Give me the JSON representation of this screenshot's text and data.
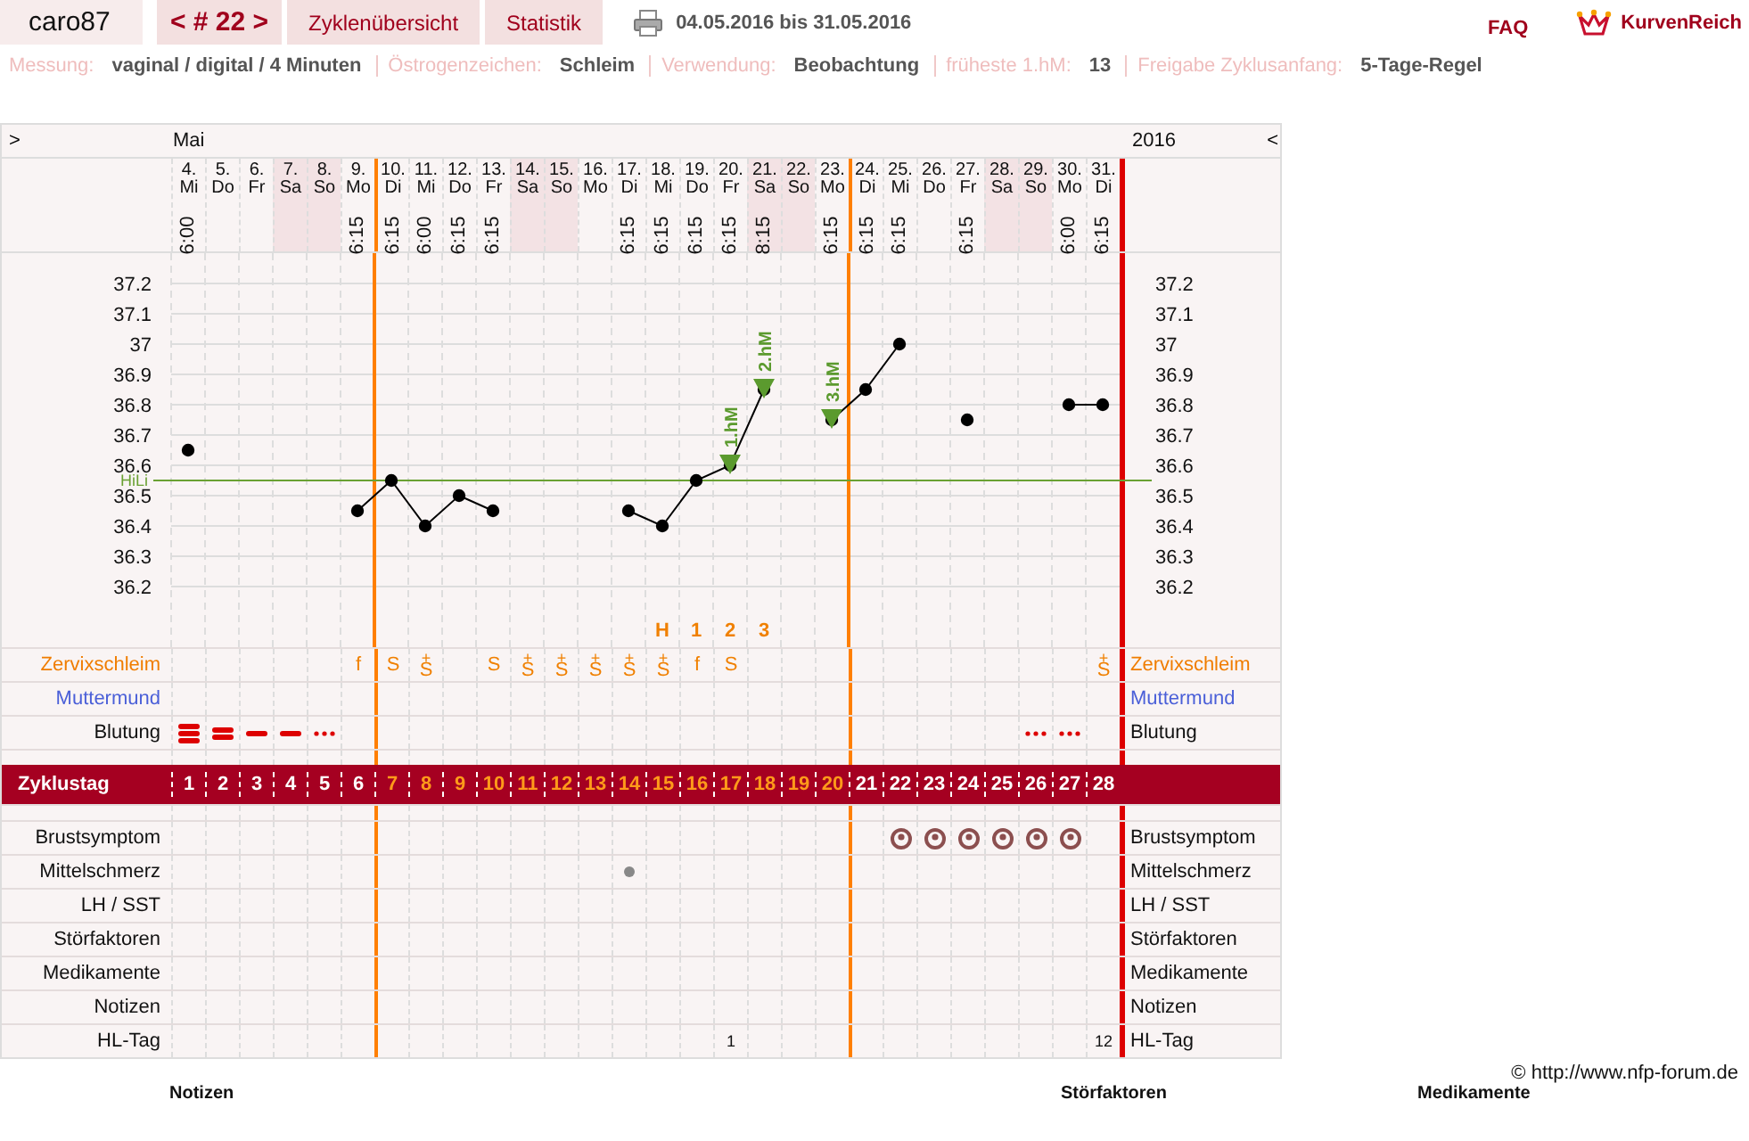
{
  "header": {
    "user": "caro87",
    "cycle_nav": "< # 22 >",
    "tabs": [
      {
        "label": "Zyklenübersicht"
      },
      {
        "label": "Statistik"
      }
    ],
    "date_range": "04.05.2016 bis 31.05.2016",
    "faq": "FAQ",
    "logo": "KurvenReich"
  },
  "settings": [
    {
      "label": "Messung:",
      "value": "vaginal / digital / 4 Minuten"
    },
    {
      "label": "Östrogenzeichen:",
      "value": "Schleim"
    },
    {
      "label": "Verwendung:",
      "value": "Beobachtung"
    },
    {
      "label": "früheste 1.hM:",
      "value": "13"
    },
    {
      "label": "Freigabe Zyklusanfang:",
      "value": "5-Tage-Regel"
    }
  ],
  "calendar": {
    "nav_left": ">",
    "month": "Mai",
    "year": "2016",
    "nav_right": "<"
  },
  "days": [
    {
      "weekday": "Mi",
      "time": "6:00",
      "weekend": false,
      "cycle_day": "1",
      "fertile": false,
      "bleeding": {
        "kind": "heavy"
      }
    },
    {
      "weekday": "Do",
      "weekend": false,
      "cycle_day": "2",
      "fertile": false,
      "bleeding": {
        "kind": "medium"
      }
    },
    {
      "weekday": "Fr",
      "weekend": false,
      "cycle_day": "3",
      "fertile": false,
      "bleeding": {
        "kind": "light"
      }
    },
    {
      "weekday": "Sa",
      "weekend": true,
      "cycle_day": "4",
      "fertile": false,
      "bleeding": {
        "kind": "light"
      }
    },
    {
      "weekday": "So",
      "weekend": true,
      "cycle_day": "5",
      "fertile": false,
      "bleeding": {
        "kind": "spotting"
      }
    },
    {
      "weekday": "Mo",
      "time": "6:15",
      "weekend": false,
      "cycle_day": "6",
      "fertile": false,
      "mucus": "f"
    },
    {
      "weekday": "Di",
      "time": "6:15",
      "weekend": false,
      "cycle_day": "7",
      "fertile": true,
      "mucus": "S"
    },
    {
      "weekday": "Mi",
      "time": "6:00",
      "weekend": false,
      "cycle_day": "8",
      "fertile": true,
      "mucus": "S",
      "mucus_mark": "+"
    },
    {
      "weekday": "Do",
      "time": "6:15",
      "weekend": false,
      "cycle_day": "9",
      "fertile": true
    },
    {
      "weekday": "Fr",
      "time": "6:15",
      "weekend": false,
      "cycle_day": "10",
      "fertile": true,
      "mucus": "S"
    },
    {
      "weekday": "Sa",
      "weekend": true,
      "cycle_day": "11",
      "fertile": true,
      "mucus": "S",
      "mucus_mark": "+"
    },
    {
      "weekday": "So",
      "weekend": true,
      "cycle_day": "12",
      "fertile": true,
      "mucus": "S",
      "mucus_mark": "+"
    },
    {
      "weekday": "Mo",
      "weekend": false,
      "cycle_day": "13",
      "fertile": true,
      "mucus": "S",
      "mucus_mark": "+"
    },
    {
      "weekday": "Di",
      "time": "6:15",
      "weekend": false,
      "cycle_day": "14",
      "fertile": true,
      "mucus": "S",
      "mucus_mark": "+",
      "pain": true
    },
    {
      "weekday": "Mi",
      "time": "6:15",
      "weekend": false,
      "cycle_day": "15",
      "fertile": true,
      "mucus": "S",
      "mucus_mark": "+",
      "marker": "H"
    },
    {
      "weekday": "Do",
      "time": "6:15",
      "weekend": false,
      "cycle_day": "16",
      "fertile": true,
      "mucus": "f",
      "marker": "1"
    },
    {
      "weekday": "Fr",
      "time": "6:15",
      "weekend": false,
      "cycle_day": "17",
      "fertile": true,
      "mucus": "S",
      "marker": "2",
      "hl_tag": "1"
    },
    {
      "weekday": "Sa",
      "time": "8:15",
      "weekend": true,
      "cycle_day": "18",
      "fertile": true,
      "marker": "3"
    },
    {
      "weekday": "So",
      "weekend": true,
      "cycle_day": "19",
      "fertile": true
    },
    {
      "weekday": "Mo",
      "time": "6:15",
      "weekend": false,
      "cycle_day": "20",
      "fertile": true
    },
    {
      "weekday": "Di",
      "time": "6:15",
      "weekend": false,
      "cycle_day": "21",
      "fertile": false
    },
    {
      "weekday": "Mi",
      "time": "6:15",
      "weekend": false,
      "cycle_day": "22",
      "fertile": false,
      "breast": true
    },
    {
      "weekday": "Do",
      "weekend": false,
      "cycle_day": "23",
      "fertile": false,
      "breast": true
    },
    {
      "weekday": "Fr",
      "time": "6:15",
      "weekend": false,
      "cycle_day": "24",
      "fertile": false,
      "breast": true
    },
    {
      "weekday": "Sa",
      "weekend": true,
      "cycle_day": "25",
      "fertile": false,
      "breast": true
    },
    {
      "weekday": "So",
      "weekend": true,
      "cycle_day": "26",
      "fertile": false,
      "breast": true,
      "bleeding": {
        "kind": "spotting"
      }
    },
    {
      "weekday": "Mo",
      "time": "6:00",
      "weekend": false,
      "cycle_day": "27",
      "fertile": false,
      "breast": true,
      "bleeding": {
        "kind": "spotting"
      }
    },
    {
      "weekday": "Di",
      "time": "6:15",
      "weekend": false,
      "cycle_day": "28",
      "fertile": false,
      "mucus": "S",
      "mucus_mark": "+",
      "hl_tag": "12"
    }
  ],
  "temperature": {
    "left_ticks": [
      "37.2",
      "37.1",
      "37",
      "36.9",
      "36.8",
      "36.7",
      "36.6",
      "36.5",
      "36.4",
      "36.3",
      "36.2"
    ],
    "chart_data": {
      "type": "line",
      "grid": true,
      "ylim": [
        36.0,
        37.3
      ],
      "yticks": [
        36.2,
        36.3,
        36.4,
        36.5,
        36.6,
        36.7,
        36.8,
        36.9,
        37,
        37.1,
        37.2
      ],
      "categories": [
        "4.",
        "5.",
        "6.",
        "7.",
        "8.",
        "9.",
        "10.",
        "11.",
        "12.",
        "13.",
        "14.",
        "15.",
        "16.",
        "17.",
        "18.",
        "19.",
        "20.",
        "21.",
        "22.",
        "23.",
        "24.",
        "25.",
        "26.",
        "27.",
        "28.",
        "29.",
        "30.",
        "31."
      ],
      "series": [
        {
          "color": "#000000",
          "marker": "o",
          "values": [
            36.65,
            null,
            null,
            null,
            null,
            36.45,
            36.55,
            36.4,
            36.5,
            36.45,
            null,
            null,
            null,
            36.45,
            36.4,
            36.55,
            36.6,
            36.85,
            null,
            36.75,
            36.85,
            37.0,
            null,
            36.75,
            null,
            null,
            36.8,
            36.8
          ]
        }
      ],
      "ref_lines": [
        {
          "axis": "y",
          "value": 36.55,
          "label": "HiLi"
        }
      ],
      "annotations": [
        {
          "x": "20.",
          "y": 36.6,
          "text": "1.hM"
        },
        {
          "x": "21.",
          "y": 36.85,
          "text": "2.hM"
        },
        {
          "x": "23.",
          "y": 36.75,
          "text": "3.hM"
        }
      ]
    }
  },
  "rows_top": [
    {
      "kind": "mucus",
      "label": "Zervixschleim",
      "label_right": "Zervixschleim"
    },
    {
      "kind": "cervix",
      "label": "Muttermund",
      "label_right": "Muttermund"
    },
    {
      "kind": "bleeding",
      "label": "Blutung",
      "label_right": "Blutung"
    }
  ],
  "cycle_row": {
    "label": "Zyklustag"
  },
  "rows_bottom": [
    {
      "kind": "breast",
      "label": "Brustsymptom",
      "label_right": "Brustsymptom"
    },
    {
      "kind": "pain",
      "label": "Mittelschmerz",
      "label_right": "Mittelschmerz"
    },
    {
      "kind": "lh",
      "label": "LH / SST",
      "label_right": "LH / SST"
    },
    {
      "kind": "disturb",
      "label": "Störfaktoren",
      "label_right": "Störfaktoren"
    },
    {
      "kind": "meds",
      "label": "Medikamente",
      "label_right": "Medikamente"
    },
    {
      "kind": "notes",
      "label": "Notizen",
      "label_right": "Notizen"
    },
    {
      "kind": "hl",
      "label": "HL-Tag",
      "label_right": "HL-Tag"
    }
  ],
  "copyright": "© http://www.nfp-forum.de",
  "sections": [
    "Notizen",
    "Störfaktoren",
    "Medikamente"
  ]
}
